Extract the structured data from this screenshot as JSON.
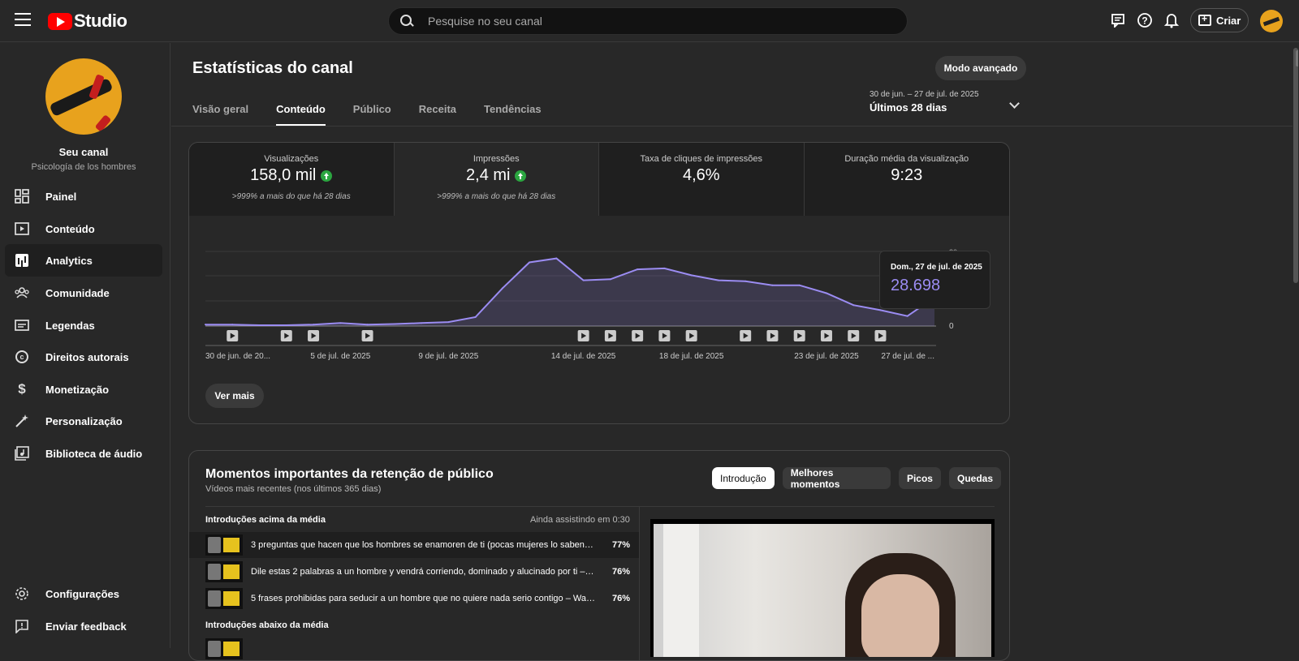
{
  "topbar": {
    "logo_text": "Studio",
    "search_placeholder": "Pesquise no seu canal",
    "create_label": "Criar"
  },
  "sidebar": {
    "channel_name": "Seu canal",
    "channel_sub": "Psicología de los hombres",
    "items": [
      {
        "label": "Painel",
        "icon": "dashboard-icon"
      },
      {
        "label": "Conteúdo",
        "icon": "content-icon"
      },
      {
        "label": "Analytics",
        "icon": "analytics-icon"
      },
      {
        "label": "Comunidade",
        "icon": "community-icon"
      },
      {
        "label": "Legendas",
        "icon": "subtitles-icon"
      },
      {
        "label": "Direitos autorais",
        "icon": "copyright-icon"
      },
      {
        "label": "Monetização",
        "icon": "monetization-icon"
      },
      {
        "label": "Personalização",
        "icon": "customization-icon"
      },
      {
        "label": "Biblioteca de áudio",
        "icon": "audio-library-icon"
      }
    ],
    "bottom_items": [
      {
        "label": "Configurações",
        "icon": "gear-icon"
      },
      {
        "label": "Enviar feedback",
        "icon": "feedback-icon"
      }
    ]
  },
  "header": {
    "title": "Estatísticas do canal",
    "advanced_label": "Modo avançado",
    "tabs": [
      "Visão geral",
      "Conteúdo",
      "Público",
      "Receita",
      "Tendências"
    ],
    "active_tab": "Conteúdo",
    "date_range": "30 de jun. – 27 de jul. de 2025",
    "date_label": "Últimos 28 dias"
  },
  "metrics": [
    {
      "label": "Visualizações",
      "value": "158,0 mil",
      "up": true,
      "sub": ">999% a mais do que há 28 dias"
    },
    {
      "label": "Impressões",
      "value": "2,4 mi",
      "up": true,
      "sub": ">999% a mais do que há 28 dias"
    },
    {
      "label": "Taxa de cliques de impressões",
      "value": "4,6%",
      "up": false,
      "sub": ""
    },
    {
      "label": "Duração média da visualização",
      "value": "9:23",
      "up": false,
      "sub": ""
    }
  ],
  "chart": {
    "y_top_label": "20",
    "y_zero_label": "0",
    "x_labels": [
      "30 de jun. de 20...",
      "5 de jul. de 2025",
      "9 de jul. de 2025",
      "14 de jul. de 2025",
      "18 de jul. de 2025",
      "23 de jul. de 2025",
      "27 de jul. de ..."
    ],
    "ver_mais": "Ver mais",
    "tooltip_date": "Dom., 27 de jul. de 2025",
    "tooltip_value": "28.698"
  },
  "chart_data": {
    "type": "area",
    "x": [
      "30/06",
      "01/07",
      "02/07",
      "03/07",
      "04/07",
      "05/07",
      "06/07",
      "07/07",
      "08/07",
      "09/07",
      "10/07",
      "11/07",
      "12/07",
      "13/07",
      "14/07",
      "15/07",
      "16/07",
      "17/07",
      "18/07",
      "19/07",
      "20/07",
      "21/07",
      "22/07",
      "23/07",
      "24/07",
      "25/07",
      "26/07",
      "27/07"
    ],
    "values": [
      1500,
      1500,
      800,
      800,
      1500,
      3000,
      1500,
      2000,
      3000,
      4000,
      9000,
      38000,
      64000,
      68000,
      46000,
      47000,
      57000,
      58000,
      51000,
      46000,
      45000,
      41000,
      41000,
      33000,
      21000,
      16000,
      10000,
      28698
    ],
    "xlabel": "",
    "ylabel": "",
    "color": "#9b8cf2"
  },
  "retention": {
    "title": "Momentos importantes da retenção de público",
    "subtitle": "Vídeos mais recentes (nos últimos 365 dias)",
    "chips": [
      "Introdução",
      "Melhores momentos",
      "Picos",
      "Quedas"
    ],
    "active_chip": "Introdução",
    "above_title": "Introduções acima da média",
    "above_right": "Ainda assistindo em 0:30",
    "videos": [
      {
        "title": "3 preguntas que hacen que los hombres se enamoren de ti (pocas mujeres lo saben) – ...",
        "pct": "77%"
      },
      {
        "title": "Dile estas 2 palabras a un hombre y vendrá corriendo, dominado y alucinado por ti – Wal...",
        "pct": "76%"
      },
      {
        "title": "5 frases prohibidas para seducir a un hombre que no quiere nada serio contigo – Walter ...",
        "pct": "76%"
      }
    ],
    "below_title": "Introduções abaixo da média"
  }
}
